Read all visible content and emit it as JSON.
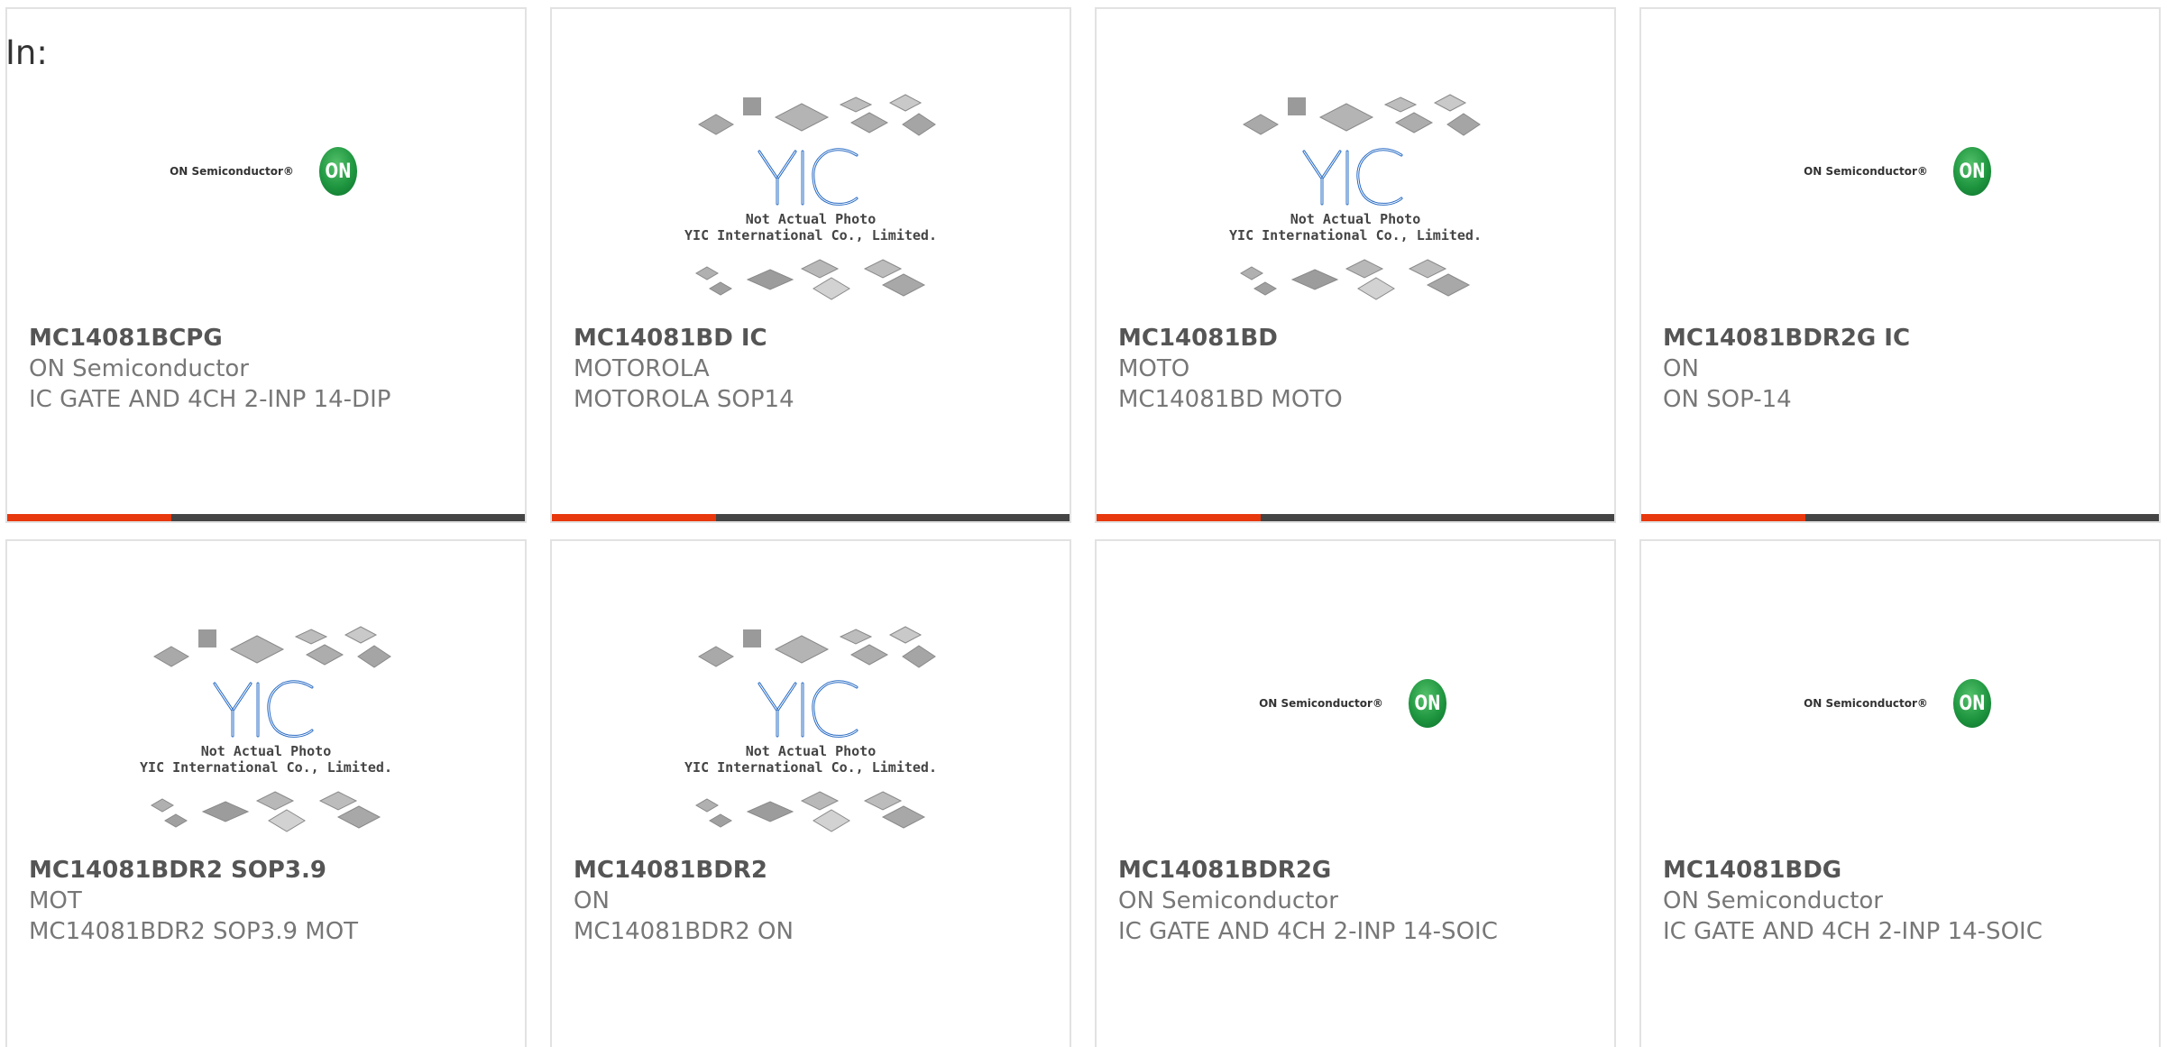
{
  "filter": {
    "label": "In:"
  },
  "products": [
    {
      "part": "MC14081BCPG",
      "manufacturer": "ON Semiconductor",
      "description": "IC GATE AND 4CH 2-INP 14-DIP",
      "image": "on-semiconductor-logo"
    },
    {
      "part": "MC14081BD IC",
      "manufacturer": "MOTOROLA",
      "description": "MOTOROLA SOP14",
      "image": "yic-not-actual-photo"
    },
    {
      "part": "MC14081BD",
      "manufacturer": "MOTO",
      "description": "MC14081BD MOTO",
      "image": "yic-not-actual-photo"
    },
    {
      "part": "MC14081BDR2G IC",
      "manufacturer": "ON",
      "description": "ON SOP-14",
      "image": "on-semiconductor-logo"
    },
    {
      "part": "MC14081BDR2 SOP3.9",
      "manufacturer": "MOT",
      "description": "MC14081BDR2 SOP3.9 MOT",
      "image": "yic-not-actual-photo"
    },
    {
      "part": "MC14081BDR2",
      "manufacturer": "ON",
      "description": "MC14081BDR2 ON",
      "image": "yic-not-actual-photo"
    },
    {
      "part": "MC14081BDR2G",
      "manufacturer": "ON Semiconductor",
      "description": "IC GATE AND 4CH 2-INP 14-SOIC",
      "image": "on-semiconductor-logo"
    },
    {
      "part": "MC14081BDG",
      "manufacturer": "ON Semiconductor",
      "description": "IC GATE AND 4CH 2-INP 14-SOIC",
      "image": "on-semiconductor-logo"
    }
  ],
  "logos": {
    "on_semi_text": "ON Semiconductor®",
    "on_badge_text": "ON",
    "yic_mark": "YIC",
    "yic_caption_line1": "Not Actual Photo",
    "yic_caption_line2": "YIC International Co., Limited."
  },
  "colors": {
    "accent_bar": "#e8380d",
    "bar": "#444444",
    "card_border": "#e2e2e2",
    "on_green": "#1f9640",
    "yic_blue": "#2a6cc4"
  }
}
